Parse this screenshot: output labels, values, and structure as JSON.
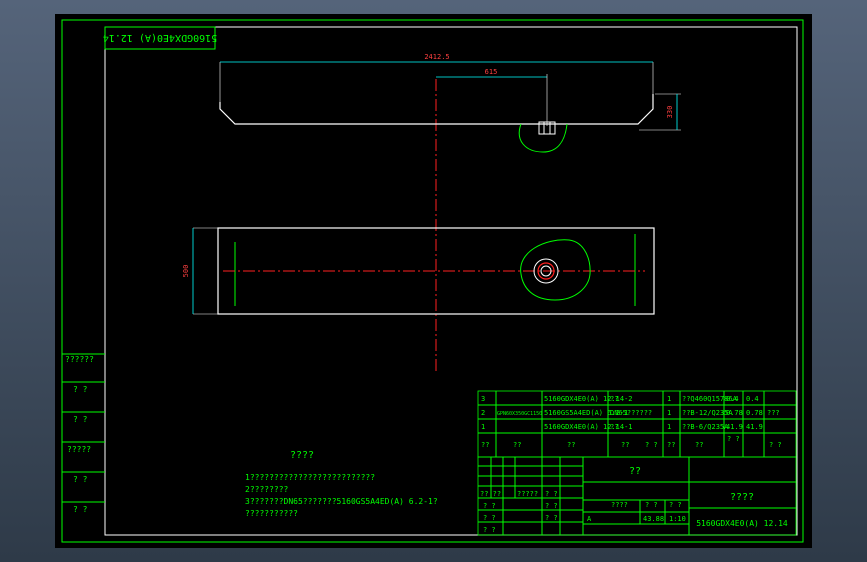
{
  "drawing": {
    "title_upside_down": "5160GDX4E0(A) 12.14",
    "dim_total": "2412.5",
    "dim_offset": "615",
    "dim_height": "330",
    "dim_width": "500"
  },
  "left_strip": [
    "??????",
    "? ?",
    "? ?",
    "?????",
    "? ?",
    "? ?"
  ],
  "notes": {
    "heading": "????",
    "lines": [
      "1??????????????????????????",
      "2????????",
      "3???????DN65???????5160GS5A4ED(A) 6.2-1?",
      "  ???????????"
    ]
  },
  "bom": {
    "rows": [
      {
        "no": "3",
        "code": "",
        "drawing": "5160GDX4E0(A) 12.14-2",
        "name": "??",
        "qty": "1",
        "mat": "??Q460Q15786A",
        "w1": "0.4",
        "w2": "0.4",
        "note": ""
      },
      {
        "no": "2",
        "code": "GPN60X350GC1150",
        "drawing": "5160GS5A4ED(A) 6.2-1",
        "name": "DN65??????",
        "qty": "1",
        "mat": "??B-12/Q235A",
        "w1": "0.78",
        "w2": "0.78",
        "note": "???"
      },
      {
        "no": "1",
        "code": "",
        "drawing": "5160GDX4E0(A) 12.14-1",
        "name": "??",
        "qty": "1",
        "mat": "??B-6/Q235A",
        "w1": "41.9",
        "w2": "41.9",
        "note": ""
      }
    ],
    "header": [
      "??",
      "??",
      "??",
      "??",
      "? ?",
      "??",
      "??",
      "? ?",
      "? ?"
    ]
  },
  "title_block": {
    "center_label": "??",
    "name_box": "????",
    "drawing_no": "5160GDX4E0(A) 12.14",
    "small_labels": [
      "?? ??",
      "?????",
      "? ?",
      "????",
      "? ?",
      "? ?",
      "? ?",
      "? ?",
      "? ?",
      "? ?",
      "? ?",
      "A",
      "43.88",
      "1:10"
    ]
  }
}
